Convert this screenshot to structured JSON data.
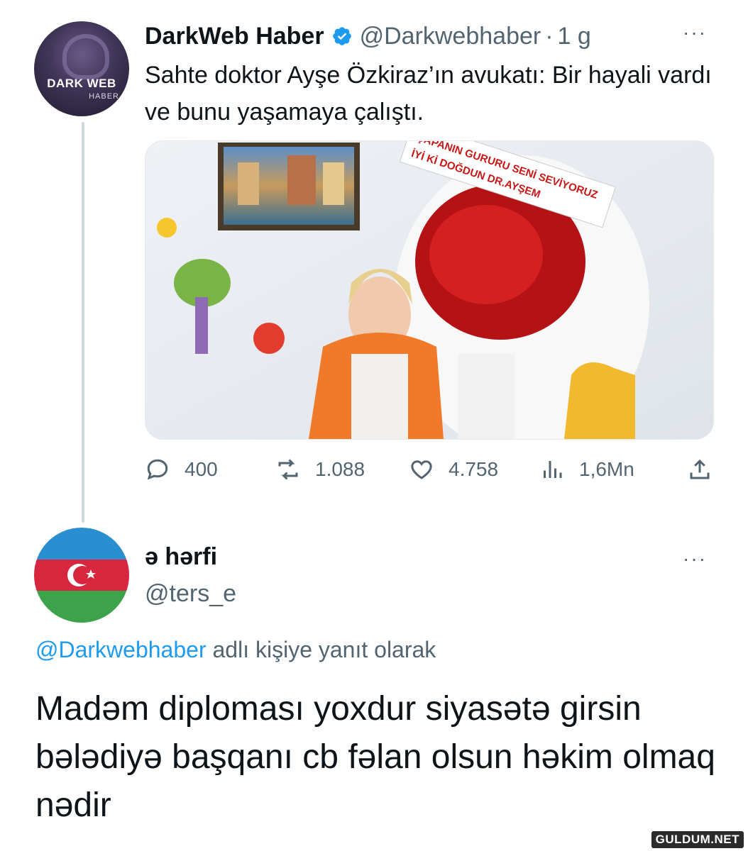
{
  "tweet1": {
    "display_name": "DarkWeb Haber",
    "handle": "@Darkwebhaber",
    "separator": "·",
    "time": "1 g",
    "text": "Sahte doktor Ayşe Özkiraz’ın avukatı: Bir hayali vardı ve bunu yaşamaya çalıştı.",
    "avatar_text": "DARK WEB",
    "avatar_subtext": "HABER",
    "media": {
      "banner_line1": "ÇAPANIN GURURU SENİ SEVİYORUZ",
      "banner_line2": "İYİ Kİ DOĞDUN DR.AYŞEM"
    },
    "actions": {
      "replies": "400",
      "retweets": "1.088",
      "likes": "4.758",
      "views": "1,6Mn"
    },
    "more_label": "···"
  },
  "tweet2": {
    "display_name": "ə hərfi",
    "handle": "@ters_e",
    "more_label": "···",
    "reply_prefix": "@Darkwebhaber",
    "reply_suffix": " adlı kişiye yanıt olarak",
    "text": "Madəm diploması yoxdur siyasətə girsin bələdiyə başqanı cb fəlan olsun həkim olmaq nədir"
  },
  "watermark": "GULDUM.NET",
  "colors": {
    "accent": "#1d9bf0",
    "secondary_text": "#536471",
    "primary_text": "#0f1419",
    "thread_line": "#cfd9de"
  },
  "icons": [
    "verified-badge-icon",
    "more-icon",
    "reply-icon",
    "retweet-icon",
    "like-icon",
    "views-icon",
    "share-icon"
  ]
}
